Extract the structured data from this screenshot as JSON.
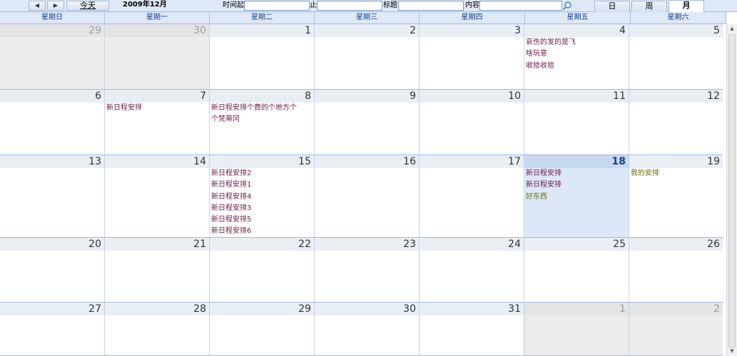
{
  "toolbar": {
    "prev_icon": "prev-triangle-icon",
    "next_icon": "next-triangle-icon",
    "today_label": "今天",
    "month_label": "2009年12月",
    "time_from_label": "时间起",
    "time_to_label": "止",
    "title_label": "标题",
    "content_label": "内容",
    "time_from_value": "",
    "time_to_value": "",
    "title_value": "",
    "content_value": "",
    "search_icon": "search-icon"
  },
  "view_tabs": [
    "日",
    "周",
    "月"
  ],
  "active_view": "月",
  "weekdays": [
    "星期日",
    "星期一",
    "星期二",
    "星期三",
    "星期四",
    "星期五",
    "星期六"
  ],
  "weeks": [
    [
      {
        "day": "29",
        "events": []
      },
      {
        "day": "30",
        "events": []
      },
      {
        "day": "1",
        "events": []
      },
      {
        "day": "2",
        "events": []
      },
      {
        "day": "3",
        "events": []
      },
      {
        "day": "4",
        "events": [
          "哀伤的发的是飞",
          "啥玩意",
          "收拾收拾"
        ]
      },
      {
        "day": "5",
        "events": []
      }
    ],
    [
      {
        "day": "6",
        "events": []
      },
      {
        "day": "7",
        "events": [
          "新日程安排"
        ]
      },
      {
        "day": "8",
        "events": [
          "新日程安排个费的个地方个个梵蒂冈"
        ]
      },
      {
        "day": "9",
        "events": []
      },
      {
        "day": "10",
        "events": []
      },
      {
        "day": "11",
        "events": []
      },
      {
        "day": "12",
        "events": []
      }
    ],
    [
      {
        "day": "13",
        "events": []
      },
      {
        "day": "14",
        "events": []
      },
      {
        "day": "15",
        "events": [
          "新日程安排2",
          "新日程安排1",
          "新日程安排4",
          "新日程安排3",
          "新日程安排5",
          "新日程安排6"
        ]
      },
      {
        "day": "16",
        "events": []
      },
      {
        "day": "17",
        "events": []
      },
      {
        "day": "18",
        "events": [
          "新日程安排",
          "新日程安排",
          "好东西"
        ]
      },
      {
        "day": "19",
        "events": [
          "我的安排"
        ]
      }
    ],
    [
      {
        "day": "20",
        "events": []
      },
      {
        "day": "21",
        "events": []
      },
      {
        "day": "22",
        "events": []
      },
      {
        "day": "23",
        "events": []
      },
      {
        "day": "24",
        "events": []
      },
      {
        "day": "25",
        "events": []
      },
      {
        "day": "26",
        "events": []
      }
    ],
    [
      {
        "day": "27",
        "events": []
      },
      {
        "day": "28",
        "events": []
      },
      {
        "day": "29",
        "events": []
      },
      {
        "day": "30",
        "events": []
      },
      {
        "day": "31",
        "events": []
      },
      {
        "day": "1",
        "events": []
      },
      {
        "day": "2",
        "events": []
      }
    ]
  ],
  "today_day": "18",
  "colors": {
    "header_bg": "#dfe8f6",
    "border": "#99bbe8",
    "today_bg": "#dce8f8",
    "other_month_bg": "#ececec",
    "event_text": "#6b1a4a",
    "event_text_alt": "#6b6b10"
  }
}
